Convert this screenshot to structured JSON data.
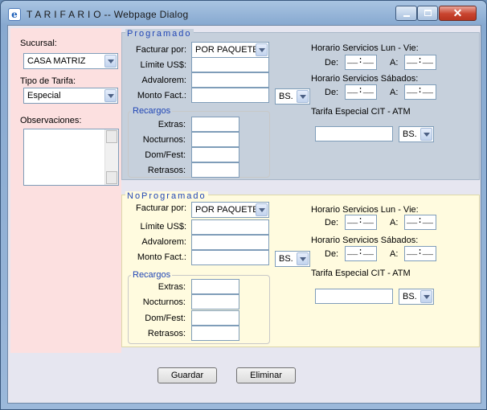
{
  "window": {
    "title": "T A R I F A R I O -- Webpage Dialog"
  },
  "left": {
    "sucursal_label": "Sucursal:",
    "sucursal_value": "CASA MATRIZ",
    "tipo_label": "Tipo de Tarifa:",
    "tipo_value": "Especial",
    "obs_label": "Observaciones:"
  },
  "programado": {
    "legend": "Programado",
    "facturar_label": "Facturar por:",
    "facturar_value": "POR PAQUETE",
    "limite_label": "Límite US$:",
    "advalorem_label": "Advalorem:",
    "monto_label": "Monto Fact.:",
    "monto_currency": "BS.",
    "recargos_legend": "Recargos",
    "extras_label": "Extras:",
    "nocturnos_label": "Nocturnos:",
    "domfest_label": "Dom/Fest:",
    "retrasos_label": "Retrasos:",
    "horario_lv_label": "Horario Servicios Lun - Vie:",
    "horario_sab_label": "Horario Servicios Sábados:",
    "de_label": "De:",
    "a_label": "A:",
    "time_placeholder": "__:__",
    "tarifa_cit_label": "Tarifa Especial CIT - ATM",
    "tarifa_cit_currency": "BS."
  },
  "noprogramado": {
    "legend": "NoProgramado",
    "facturar_label": "Facturar por:",
    "facturar_value": "POR PAQUETE",
    "limite_label": "Límite US$:",
    "advalorem_label": "Advalorem:",
    "monto_label": "Monto Fact.:",
    "monto_currency": "BS.",
    "recargos_legend": "Recargos",
    "extras_label": "Extras:",
    "nocturnos_label": "Nocturnos:",
    "domfest_label": "Dom/Fest:",
    "retrasos_label": "Retrasos:",
    "horario_lv_label": "Horario Servicios Lun - Vie:",
    "horario_sab_label": "Horario Servicios Sábados:",
    "de_label": "De:",
    "a_label": "A:",
    "time_placeholder": "__:__",
    "tarifa_cit_label": "Tarifa Especial CIT - ATM",
    "tarifa_cit_currency": "BS."
  },
  "buttons": {
    "guardar": "Guardar",
    "eliminar": "Eliminar"
  }
}
